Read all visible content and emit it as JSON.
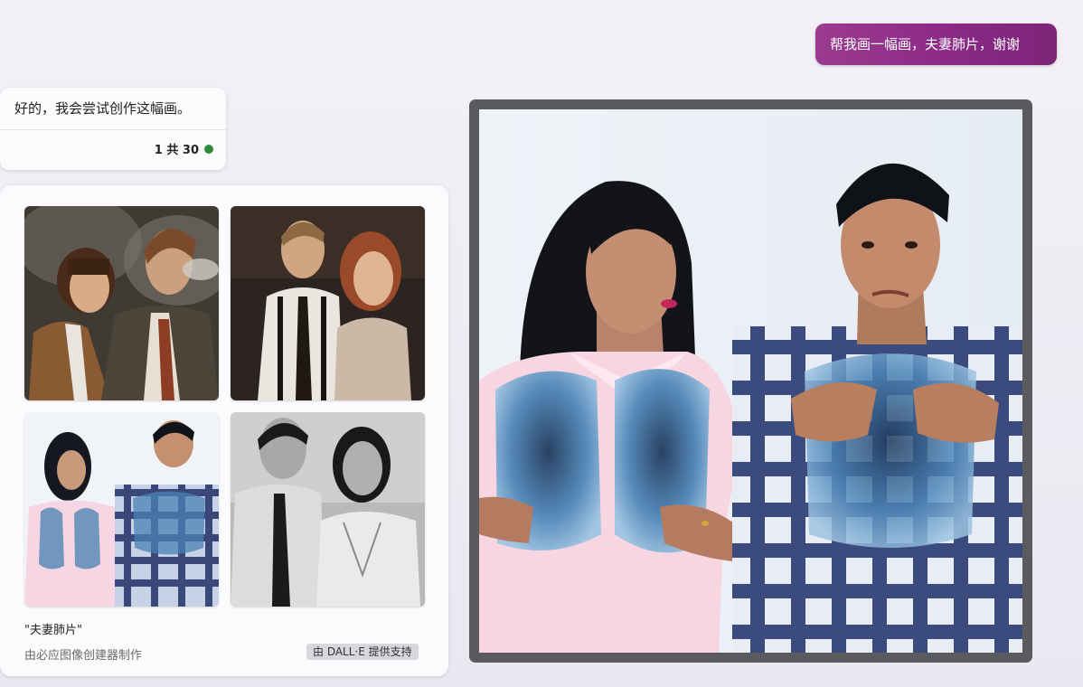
{
  "user_message": "帮我画一幅画，夫妻肺片，谢谢",
  "bot_message": {
    "text": "好的，我会尝试创作这幅画。",
    "count": "1 共 30"
  },
  "image_card": {
    "caption": "\"夫妻肺片\"",
    "creator": "由必应图像创建器制作",
    "powered_by": "由 DALL·E 提供支持"
  },
  "colors": {
    "user_bubble": "#8a2a86",
    "status_dot": "#2e8b3a",
    "frame": "#5b5a5e"
  }
}
